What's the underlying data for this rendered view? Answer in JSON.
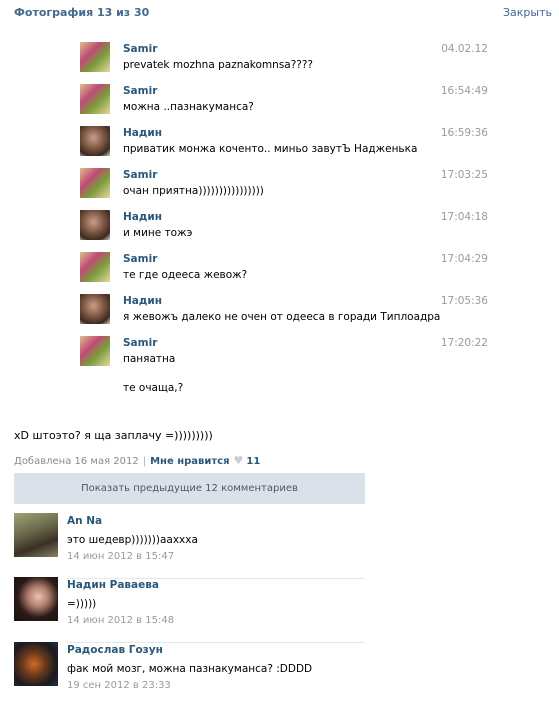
{
  "header": {
    "title": "Фотография 13 из 30",
    "close_label": "Закрыть"
  },
  "chat": [
    {
      "name": "Samir",
      "text": "prevatek mozhna paznakomnsa????",
      "time": "04.02.12",
      "avatar": "samir"
    },
    {
      "name": "Samir",
      "text": "можна ..пазнакуманса?",
      "time": "16:54:49",
      "avatar": "samir"
    },
    {
      "name": "Надин",
      "text": "приватик монжа коченто.. миньо завутЪ Надженька",
      "time": "16:59:36",
      "avatar": "nadin"
    },
    {
      "name": "Samir",
      "text": "очан приятна))))))))))))))))",
      "time": "17:03:25",
      "avatar": "samir"
    },
    {
      "name": "Надин",
      "text": "и мине тожэ",
      "time": "17:04:18",
      "avatar": "nadin"
    },
    {
      "name": "Samir",
      "text": "те где одееса жевож?",
      "time": "17:04:29",
      "avatar": "samir"
    },
    {
      "name": "Надин",
      "text": "я жевожъ далеко не очен от одееса в горади Типлоадра",
      "time": "17:05:36",
      "avatar": "nadin"
    },
    {
      "name": "Samir",
      "text": "паняатна",
      "extra": "те очаща,?",
      "time": "17:20:22",
      "avatar": "samir"
    }
  ],
  "post": {
    "caption": "xD штоэто? я ща заплачу =)))))))))",
    "added": "Добавлена 16 мая 2012",
    "like_label": "Мне нравится",
    "like_count": "11",
    "show_prev": "Показать предыдущие 12 комментариев"
  },
  "comments": [
    {
      "name": "An Na",
      "text": "это шедевр)))))))аахxха",
      "date": "14 июн 2012 в 15:47",
      "avatar": "anna"
    },
    {
      "name": "Надин Раваева",
      "text": "=)))))",
      "date": "14 июн 2012 в 15:48",
      "avatar": "nadiya"
    },
    {
      "name": "Радослав Гозун",
      "text": "фак мой мозг, можна пазнакуманса? :DDDD",
      "date": "19 сен 2012 в 23:33",
      "avatar": "rad"
    }
  ],
  "colors": {
    "link": "#2b587a",
    "header_link": "#45688e",
    "muted": "#9a9a9a",
    "button_bg": "#dae1e8"
  }
}
